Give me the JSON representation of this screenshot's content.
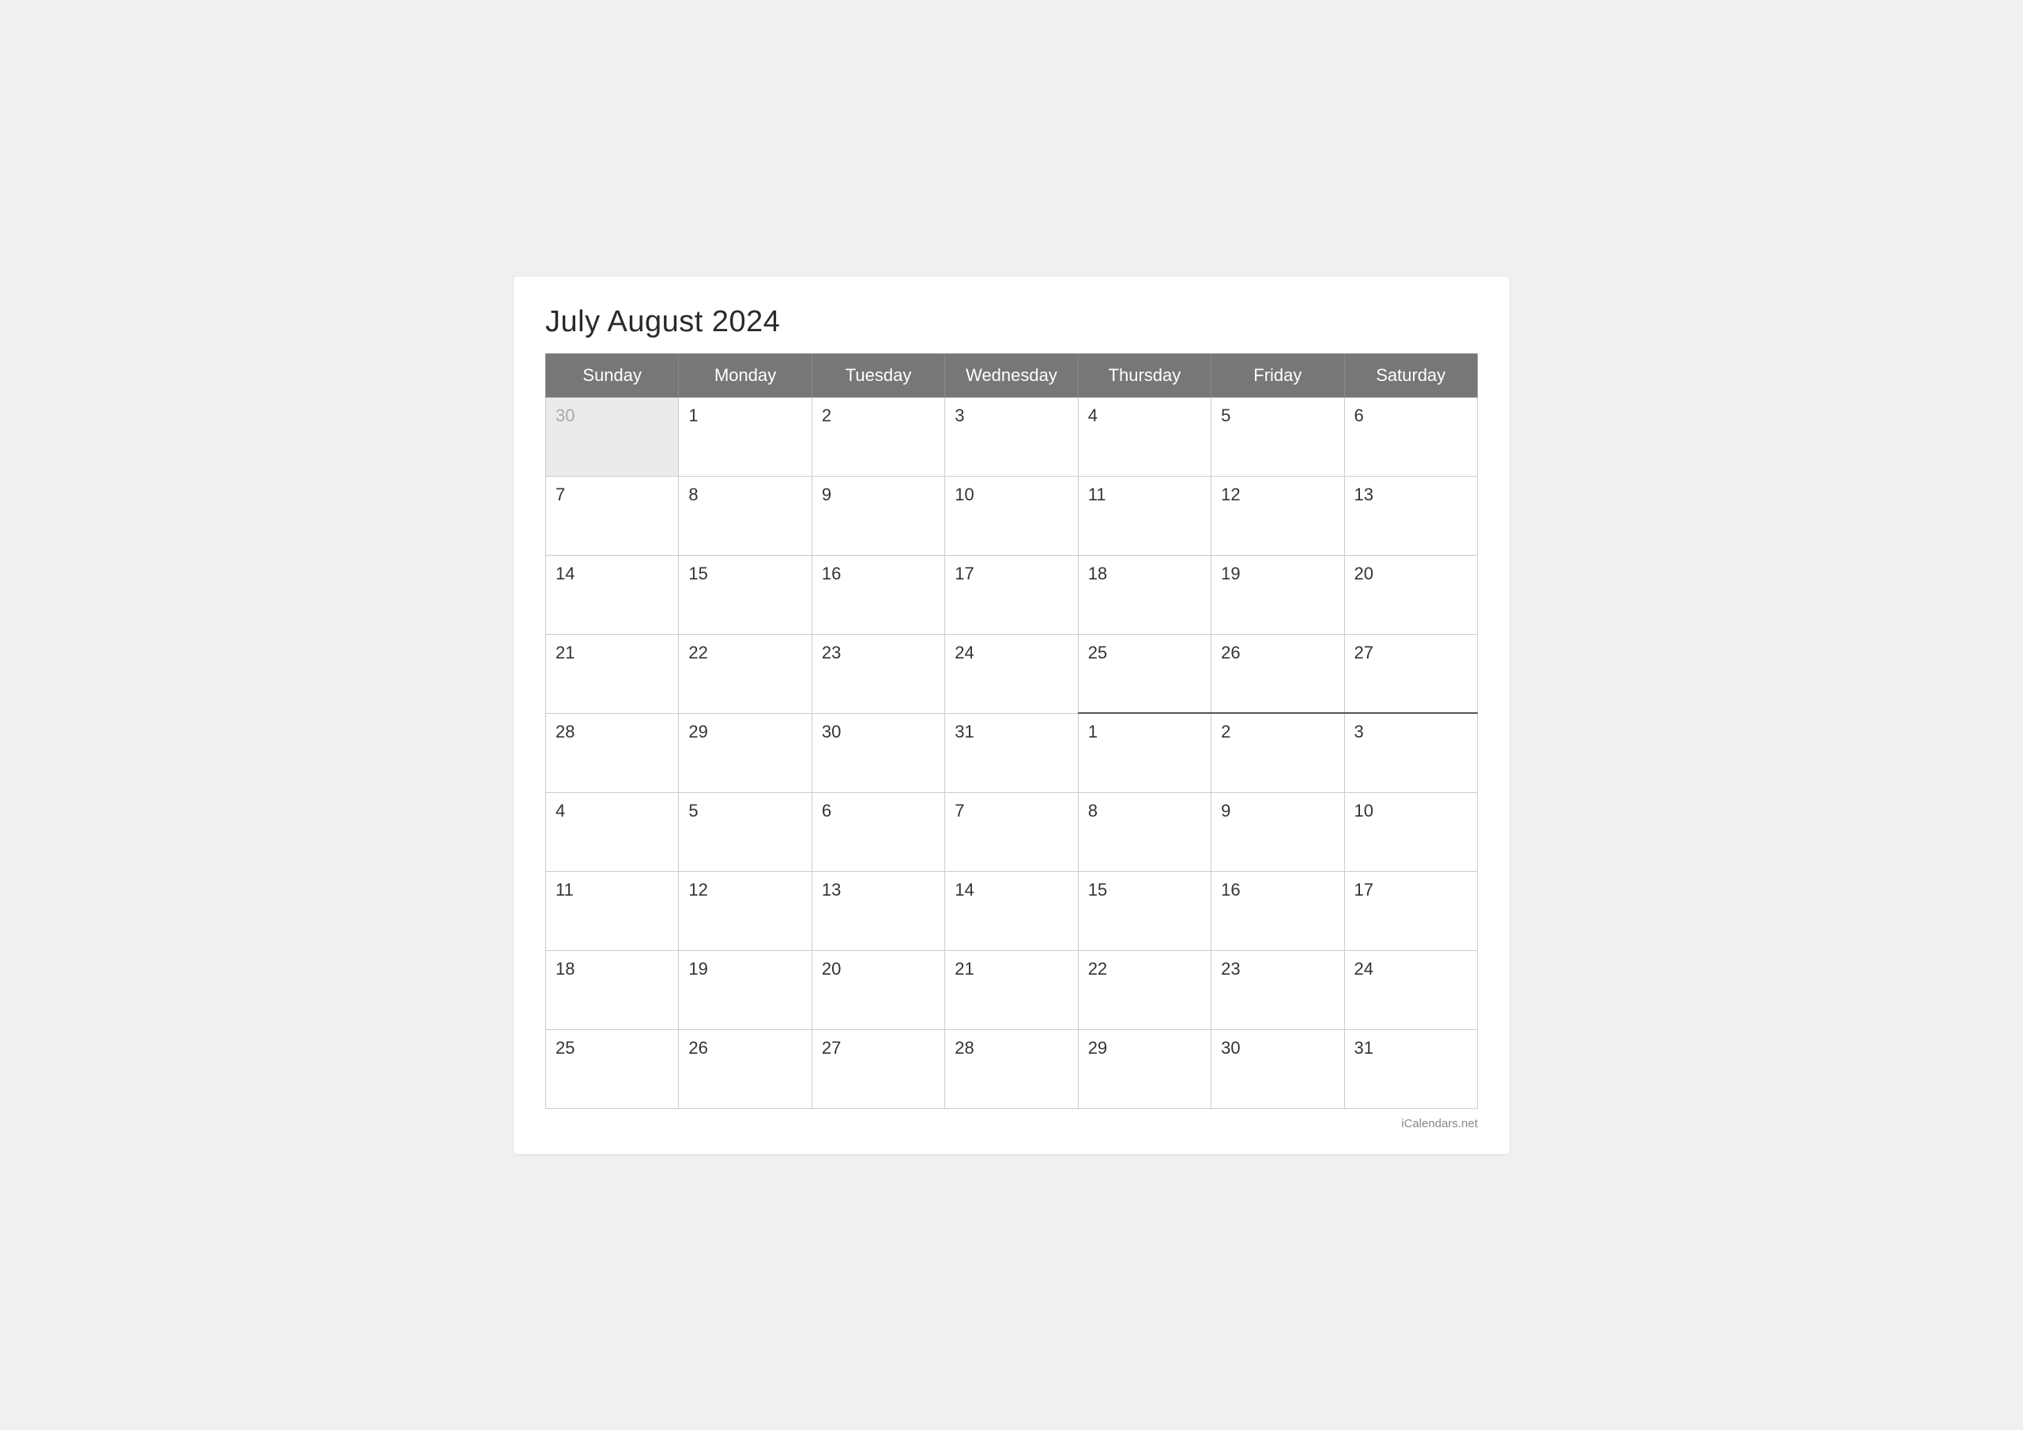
{
  "title": "July August 2024",
  "footer": "iCalendars.net",
  "headers": [
    "Sunday",
    "Monday",
    "Tuesday",
    "Wednesday",
    "Thursday",
    "Friday",
    "Saturday"
  ],
  "weeks": [
    {
      "cells": [
        {
          "day": "30",
          "type": "prev-month"
        },
        {
          "day": "1",
          "type": "current"
        },
        {
          "day": "2",
          "type": "current"
        },
        {
          "day": "3",
          "type": "current"
        },
        {
          "day": "4",
          "type": "current"
        },
        {
          "day": "5",
          "type": "current"
        },
        {
          "day": "6",
          "type": "current"
        }
      ]
    },
    {
      "cells": [
        {
          "day": "7",
          "type": "current"
        },
        {
          "day": "8",
          "type": "current"
        },
        {
          "day": "9",
          "type": "current"
        },
        {
          "day": "10",
          "type": "current"
        },
        {
          "day": "11",
          "type": "current"
        },
        {
          "day": "12",
          "type": "current"
        },
        {
          "day": "13",
          "type": "current"
        }
      ]
    },
    {
      "cells": [
        {
          "day": "14",
          "type": "current"
        },
        {
          "day": "15",
          "type": "current"
        },
        {
          "day": "16",
          "type": "current"
        },
        {
          "day": "17",
          "type": "current"
        },
        {
          "day": "18",
          "type": "current"
        },
        {
          "day": "19",
          "type": "current"
        },
        {
          "day": "20",
          "type": "current"
        }
      ]
    },
    {
      "cells": [
        {
          "day": "21",
          "type": "current"
        },
        {
          "day": "22",
          "type": "current"
        },
        {
          "day": "23",
          "type": "current"
        },
        {
          "day": "24",
          "type": "current"
        },
        {
          "day": "25",
          "type": "current"
        },
        {
          "day": "26",
          "type": "current"
        },
        {
          "day": "27",
          "type": "current"
        }
      ]
    },
    {
      "cells": [
        {
          "day": "28",
          "type": "current"
        },
        {
          "day": "29",
          "type": "current"
        },
        {
          "day": "30",
          "type": "current"
        },
        {
          "day": "31",
          "type": "current"
        },
        {
          "day": "1",
          "type": "next-month divider"
        },
        {
          "day": "2",
          "type": "next-month"
        },
        {
          "day": "3",
          "type": "next-month"
        }
      ]
    },
    {
      "cells": [
        {
          "day": "4",
          "type": "next-month"
        },
        {
          "day": "5",
          "type": "next-month"
        },
        {
          "day": "6",
          "type": "next-month"
        },
        {
          "day": "7",
          "type": "next-month"
        },
        {
          "day": "8",
          "type": "next-month"
        },
        {
          "day": "9",
          "type": "next-month"
        },
        {
          "day": "10",
          "type": "next-month"
        }
      ]
    },
    {
      "cells": [
        {
          "day": "11",
          "type": "next-month"
        },
        {
          "day": "12",
          "type": "next-month"
        },
        {
          "day": "13",
          "type": "next-month"
        },
        {
          "day": "14",
          "type": "next-month"
        },
        {
          "day": "15",
          "type": "next-month"
        },
        {
          "day": "16",
          "type": "next-month"
        },
        {
          "day": "17",
          "type": "next-month"
        }
      ]
    },
    {
      "cells": [
        {
          "day": "18",
          "type": "next-month"
        },
        {
          "day": "19",
          "type": "next-month"
        },
        {
          "day": "20",
          "type": "next-month"
        },
        {
          "day": "21",
          "type": "next-month"
        },
        {
          "day": "22",
          "type": "next-month"
        },
        {
          "day": "23",
          "type": "next-month"
        },
        {
          "day": "24",
          "type": "next-month"
        }
      ]
    },
    {
      "cells": [
        {
          "day": "25",
          "type": "next-month"
        },
        {
          "day": "26",
          "type": "next-month"
        },
        {
          "day": "27",
          "type": "next-month"
        },
        {
          "day": "28",
          "type": "next-month"
        },
        {
          "day": "29",
          "type": "next-month"
        },
        {
          "day": "30",
          "type": "next-month"
        },
        {
          "day": "31",
          "type": "next-month"
        }
      ]
    }
  ]
}
